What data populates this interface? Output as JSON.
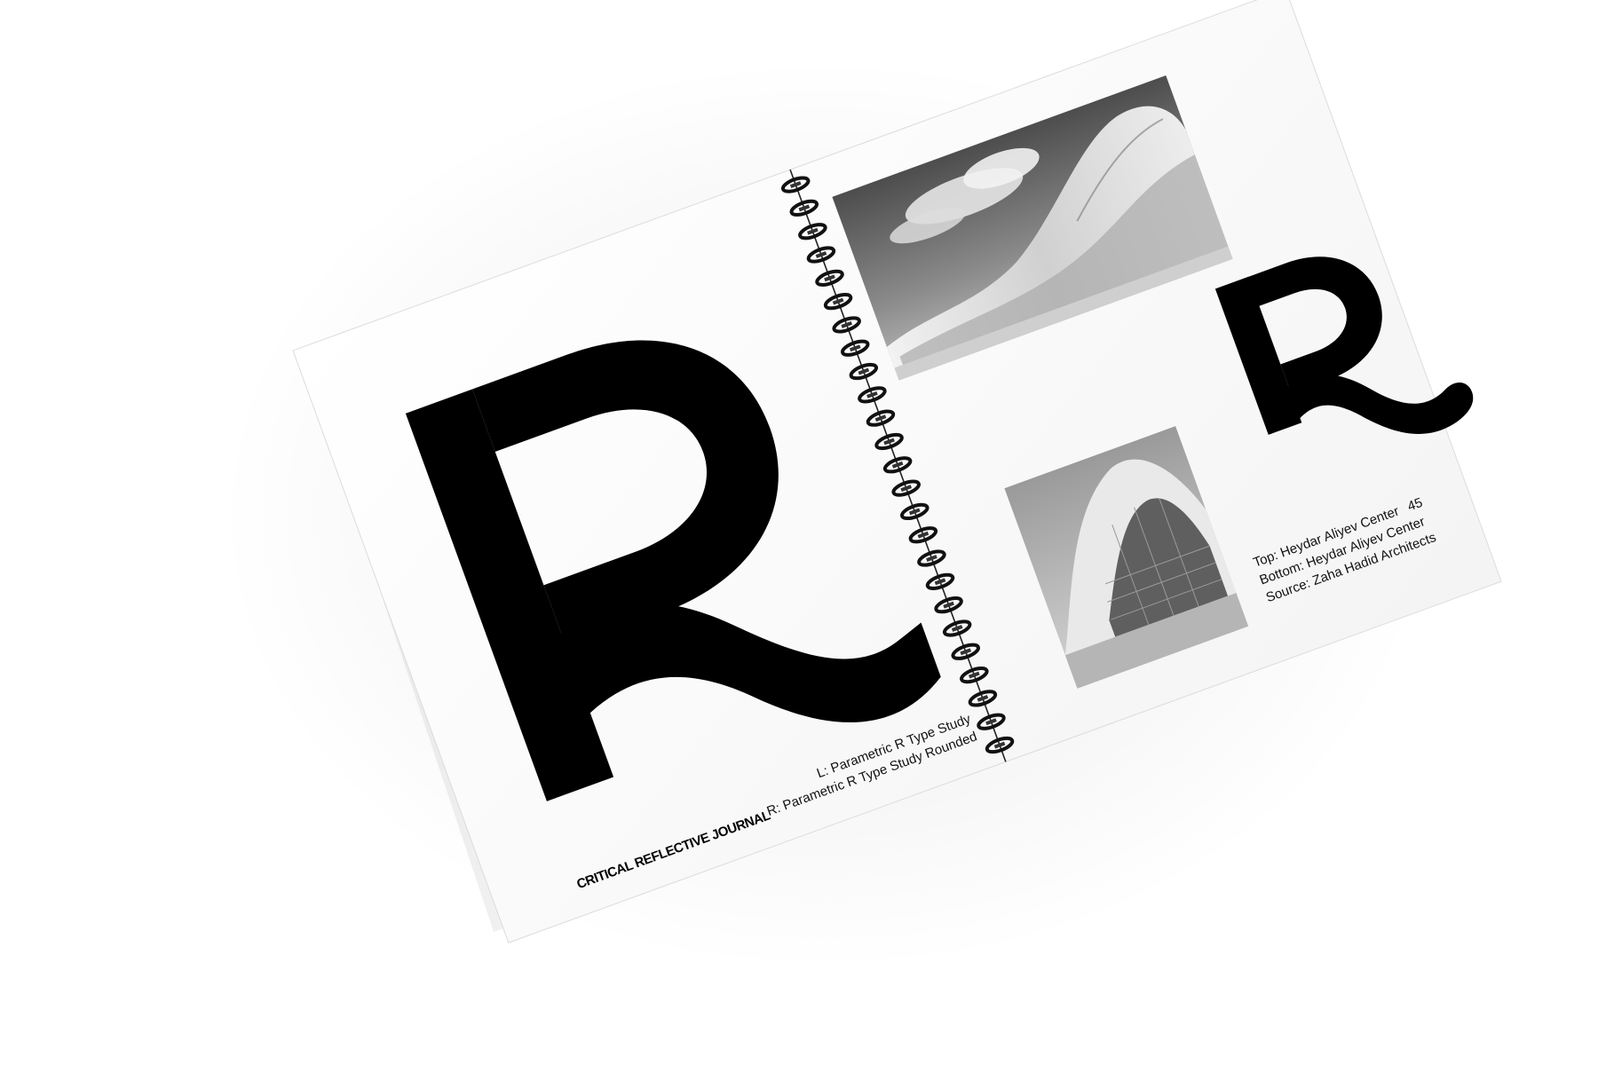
{
  "journal": {
    "running_title": "CRITICAL REFLECTIVE JOURNAL",
    "page_number": "45"
  },
  "left_page": {
    "display_letter": "R",
    "caption_line_1": "L: Parametric R Type Study",
    "caption_line_2": "R: Parametric R Type Study Rounded"
  },
  "right_page": {
    "display_letter": "R",
    "caption_line_1": "Top: Heydar Aliyev Center",
    "caption_line_2": "Bottom: Heydar Aliyev Center",
    "caption_line_3": "Source: Zaha Hadid Architects",
    "photo_top": "heydar-aliyev-center-exterior-photo",
    "photo_bottom": "heydar-aliyev-center-facade-photo"
  },
  "binding": {
    "type": "spiral",
    "coil_count": 25
  },
  "colors": {
    "paper": "#ffffff",
    "ink": "#000000",
    "background": "#ffffff"
  }
}
